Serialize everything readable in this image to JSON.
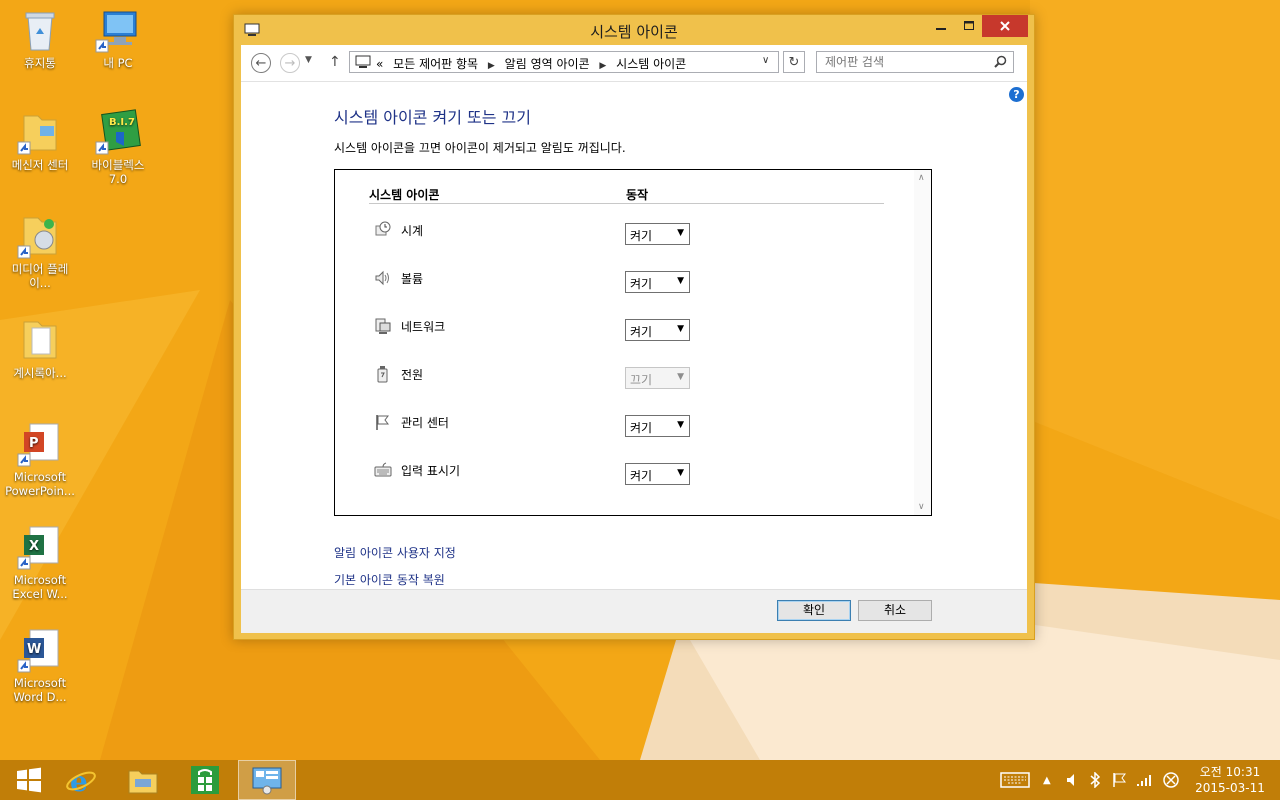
{
  "window": {
    "title": "시스템 아이콘",
    "address": {
      "overflow": "«",
      "crumbs": [
        "모든 제어판 항목",
        "알림 영역 아이콘",
        "시스템 아이콘"
      ]
    },
    "search_placeholder": "제어판 검색",
    "help": "?"
  },
  "page": {
    "title": "시스템 아이콘 켜기 또는 끄기",
    "description": "시스템 아이콘을 끄면 아이콘이 제거되고 알림도 꺼집니다.",
    "col_icon": "시스템 아이콘",
    "col_action": "동작",
    "rows": [
      {
        "name": "시계",
        "value": "켜기",
        "icon": "clock-icon",
        "disabled": false
      },
      {
        "name": "볼륨",
        "value": "켜기",
        "icon": "volume-icon",
        "disabled": false
      },
      {
        "name": "네트워크",
        "value": "켜기",
        "icon": "network-icon",
        "disabled": false
      },
      {
        "name": "전원",
        "value": "끄기",
        "icon": "power-icon",
        "disabled": true
      },
      {
        "name": "관리 센터",
        "value": "켜기",
        "icon": "flag-icon",
        "disabled": false
      },
      {
        "name": "입력 표시기",
        "value": "켜기",
        "icon": "keyboard-icon",
        "disabled": false
      }
    ],
    "link_customize": "알림 아이콘 사용자 지정",
    "link_restore": "기본 아이콘 동작 복원",
    "ok": "확인",
    "cancel": "취소"
  },
  "desktop": {
    "icons": [
      {
        "label": "휴지통",
        "icon": "recycle-bin-icon"
      },
      {
        "label": "내 PC",
        "icon": "this-pc-icon"
      },
      {
        "label": "메신저 센터",
        "icon": "folder-shortcut-icon"
      },
      {
        "label": "바이블렉스 7.0",
        "icon": "biblex-icon"
      },
      {
        "label": "미디어 플레이...",
        "icon": "media-folder-icon"
      },
      {
        "label": "계시록아...",
        "icon": "folder-icon"
      },
      {
        "label": "Microsoft PowerPoin...",
        "icon": "powerpoint-icon"
      },
      {
        "label": "Microsoft Excel W...",
        "icon": "excel-icon"
      },
      {
        "label": "Microsoft Word D...",
        "icon": "word-icon"
      }
    ]
  },
  "taskbar": {
    "time": "오전 10:31",
    "date": "2015-03-11",
    "items": [
      "start-icon",
      "internet-explorer-icon",
      "file-explorer-icon",
      "store-icon",
      "control-panel-icon"
    ]
  },
  "colors": {
    "wallpaper": "#f3a716",
    "window_frame": "#f0c14b",
    "link": "#1e3287",
    "close_button": "#c7382c",
    "taskbar": "#c17e08"
  }
}
